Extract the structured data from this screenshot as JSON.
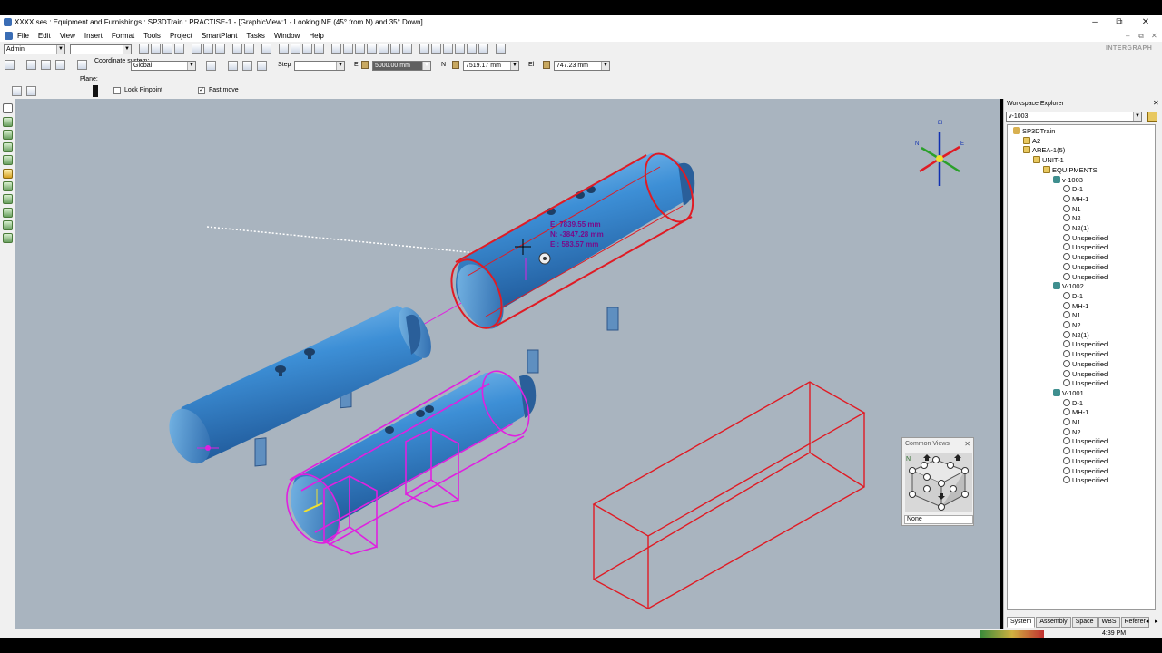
{
  "window": {
    "title": "XXXX.ses : Equipment and Furnishings : SP3DTrain : PRACTISE-1 - [GraphicView:1 - Looking NE (45° from N) and 35° Down]",
    "minimize": "–",
    "maximize": "⧉",
    "close": "✕"
  },
  "menu": {
    "items": [
      "File",
      "Edit",
      "View",
      "Insert",
      "Format",
      "Tools",
      "Project",
      "SmartPlant",
      "Tasks",
      "Window",
      "Help"
    ]
  },
  "toolbar": {
    "permission_group": "Admin",
    "second_combo": "",
    "brand": "INTERGRAPH"
  },
  "pinpoint_bar": {
    "coordinate_system_label": "Coordinate system:",
    "coordinate_system_value": "Global",
    "step_label": "Step",
    "step_value": "",
    "e_label": "E",
    "e_value": "5000.00 mm",
    "n_label": "N",
    "n_value": "7519.17 mm",
    "el_label": "El",
    "el_value": "747.23 mm"
  },
  "options_bar": {
    "plane_label": "Plane:",
    "lock_pinpoint_label": "Lock Pinpoint",
    "lock_pinpoint_checked": false,
    "fast_move_label": "Fast move",
    "fast_move_checked": true
  },
  "viewport": {
    "readout": {
      "e": "E: 7839.55 mm",
      "n": "N: -3847.28 mm",
      "el": "El: 583.57 mm"
    },
    "compass": {
      "top": "El",
      "left": "N",
      "right": "E"
    },
    "colors": {
      "background": "#a9b4bf",
      "vessel_blue": "#3d8fd6",
      "highlight_red": "#e01b24",
      "select_magenta": "#e020e0"
    }
  },
  "common_views": {
    "title": "Common Views",
    "close": "✕",
    "selected": "None"
  },
  "workspace_explorer": {
    "title": "Workspace Explorer",
    "close": "✕",
    "filter_value": "v-1003",
    "tree": [
      {
        "label": "SP3DTrain",
        "level": 0,
        "icon": "sys"
      },
      {
        "label": "A2",
        "level": 1,
        "icon": "fold"
      },
      {
        "label": "AREA-1(5)",
        "level": 1,
        "icon": "fold"
      },
      {
        "label": "UNIT-1",
        "level": 2,
        "icon": "fold"
      },
      {
        "label": "EQUIPMENTS",
        "level": 3,
        "icon": "fold"
      },
      {
        "label": "v-1003",
        "level": 4,
        "icon": "eq"
      },
      {
        "label": "D-1",
        "level": 5,
        "icon": "noz"
      },
      {
        "label": "MH-1",
        "level": 5,
        "icon": "noz"
      },
      {
        "label": "N1",
        "level": 5,
        "icon": "noz"
      },
      {
        "label": "N2",
        "level": 5,
        "icon": "noz"
      },
      {
        "label": "N2(1)",
        "level": 5,
        "icon": "noz"
      },
      {
        "label": "Unspecified",
        "level": 5,
        "icon": "noz"
      },
      {
        "label": "Unspecified",
        "level": 5,
        "icon": "noz"
      },
      {
        "label": "Unspecified",
        "level": 5,
        "icon": "noz"
      },
      {
        "label": "Unspecified",
        "level": 5,
        "icon": "noz"
      },
      {
        "label": "Unspecified",
        "level": 5,
        "icon": "noz"
      },
      {
        "label": "V-1002",
        "level": 4,
        "icon": "eq"
      },
      {
        "label": "D-1",
        "level": 5,
        "icon": "noz"
      },
      {
        "label": "MH-1",
        "level": 5,
        "icon": "noz"
      },
      {
        "label": "N1",
        "level": 5,
        "icon": "noz"
      },
      {
        "label": "N2",
        "level": 5,
        "icon": "noz"
      },
      {
        "label": "N2(1)",
        "level": 5,
        "icon": "noz"
      },
      {
        "label": "Unspecified",
        "level": 5,
        "icon": "noz"
      },
      {
        "label": "Unspecified",
        "level": 5,
        "icon": "noz"
      },
      {
        "label": "Unspecified",
        "level": 5,
        "icon": "noz"
      },
      {
        "label": "Unspecified",
        "level": 5,
        "icon": "noz"
      },
      {
        "label": "Unspecified",
        "level": 5,
        "icon": "noz"
      },
      {
        "label": "V-1001",
        "level": 4,
        "icon": "eq"
      },
      {
        "label": "D-1",
        "level": 5,
        "icon": "noz"
      },
      {
        "label": "MH-1",
        "level": 5,
        "icon": "noz"
      },
      {
        "label": "N1",
        "level": 5,
        "icon": "noz"
      },
      {
        "label": "N2",
        "level": 5,
        "icon": "noz"
      },
      {
        "label": "Unspecified",
        "level": 5,
        "icon": "noz"
      },
      {
        "label": "Unspecified",
        "level": 5,
        "icon": "noz"
      },
      {
        "label": "Unspecified",
        "level": 5,
        "icon": "noz"
      },
      {
        "label": "Unspecified",
        "level": 5,
        "icon": "noz"
      },
      {
        "label": "Unspecified",
        "level": 5,
        "icon": "noz"
      }
    ],
    "tabs": [
      "System",
      "Assembly",
      "Space",
      "WBS",
      "Referer"
    ]
  },
  "status": {
    "time": "4:39 PM"
  }
}
